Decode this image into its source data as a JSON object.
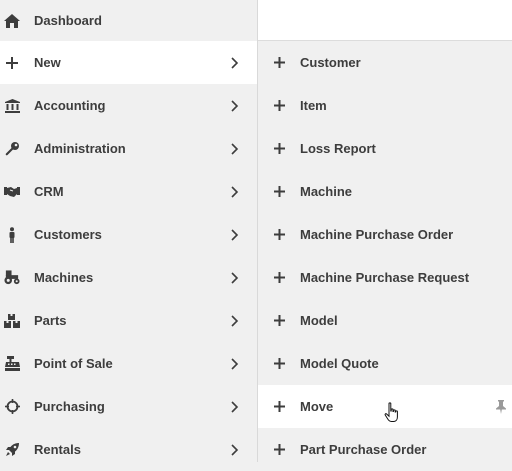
{
  "left_menu": [
    {
      "label": "Dashboard",
      "icon": "home-icon",
      "has_submenu": false
    },
    {
      "label": "New",
      "icon": "plus-icon",
      "has_submenu": true,
      "active": true
    },
    {
      "label": "Accounting",
      "icon": "bank-icon",
      "has_submenu": true
    },
    {
      "label": "Administration",
      "icon": "wrench-icon",
      "has_submenu": true
    },
    {
      "label": "CRM",
      "icon": "handshake-icon",
      "has_submenu": true
    },
    {
      "label": "Customers",
      "icon": "person-icon",
      "has_submenu": true
    },
    {
      "label": "Machines",
      "icon": "tractor-icon",
      "has_submenu": true
    },
    {
      "label": "Parts",
      "icon": "boxes-icon",
      "has_submenu": true
    },
    {
      "label": "Point of Sale",
      "icon": "cash-register-icon",
      "has_submenu": true
    },
    {
      "label": "Purchasing",
      "icon": "crosshairs-icon",
      "has_submenu": true
    },
    {
      "label": "Rentals",
      "icon": "rocket-icon",
      "has_submenu": true
    }
  ],
  "submenu": [
    {
      "label": "Customer"
    },
    {
      "label": "Item"
    },
    {
      "label": "Loss Report"
    },
    {
      "label": "Machine"
    },
    {
      "label": "Machine Purchase Order"
    },
    {
      "label": "Machine Purchase Request"
    },
    {
      "label": "Model"
    },
    {
      "label": "Model Quote"
    },
    {
      "label": "Move",
      "hovered": true
    },
    {
      "label": "Part Purchase Order"
    }
  ],
  "colors": {
    "text": "#3d3d3d",
    "background": "#f0f0f0",
    "active_row": "#ffffff"
  }
}
